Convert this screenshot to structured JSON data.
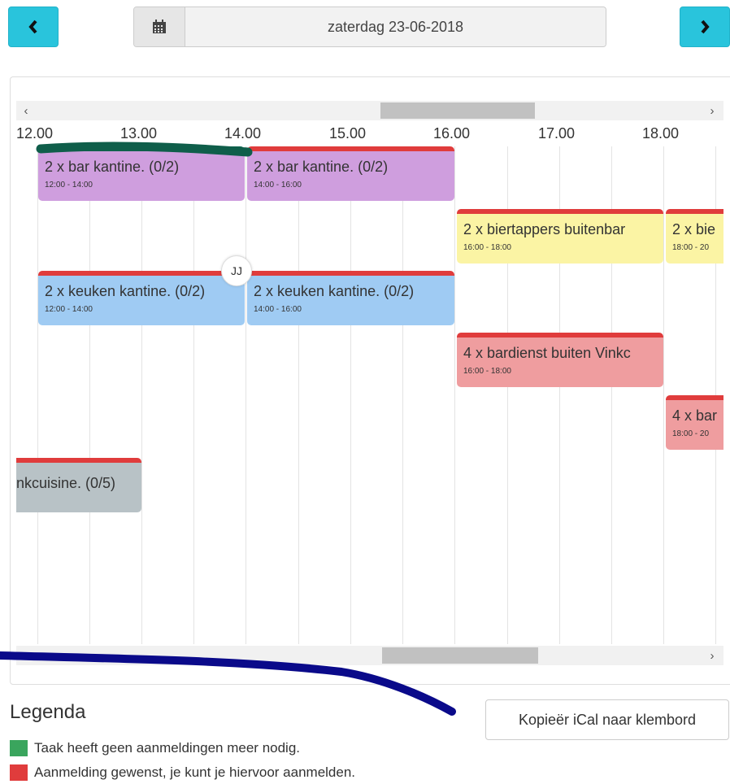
{
  "nav": {
    "prev_icon": "chevron-left-icon",
    "next_icon": "chevron-right-icon",
    "calendar_icon": "calendar-icon",
    "date": "zaterdag 23-06-2018"
  },
  "timeline": {
    "hours": [
      "12.00",
      "13.00",
      "14.00",
      "15.00",
      "16.00",
      "17.00",
      "18.00"
    ],
    "events": [
      {
        "title": "2 x bar kantine. (0/2)",
        "time": "12:00 - 14:00"
      },
      {
        "title": "2 x bar kantine. (0/2)",
        "time": "14:00 - 16:00"
      },
      {
        "title": "2 x biertappers buitenbar",
        "time": "16:00 - 18:00"
      },
      {
        "title": "2 x bie",
        "time": "18:00 - 20"
      },
      {
        "title": "2 x keuken kantine. (0/2)",
        "time": "12:00 - 14:00"
      },
      {
        "title": "2 x keuken kantine. (0/2)",
        "time": "14:00 - 16:00"
      },
      {
        "title": "4 x bardienst buiten Vinkc",
        "time": "16:00 - 18:00"
      },
      {
        "title": "4 x bar",
        "time": "18:00 - 20"
      },
      {
        "title": "nkcuisine. (0/5)"
      }
    ],
    "avatar": "JJ"
  },
  "legend": {
    "title": "Legenda",
    "ical_button": "Kopieër iCal naar klembord",
    "items": [
      {
        "label": "Taak heeft geen aanmeldingen meer nodig.",
        "color": "#3aa55d"
      },
      {
        "label": "Aanmelding gewenst, je kunt je hiervoor aanmelden.",
        "color": "#e03c3c"
      }
    ]
  }
}
